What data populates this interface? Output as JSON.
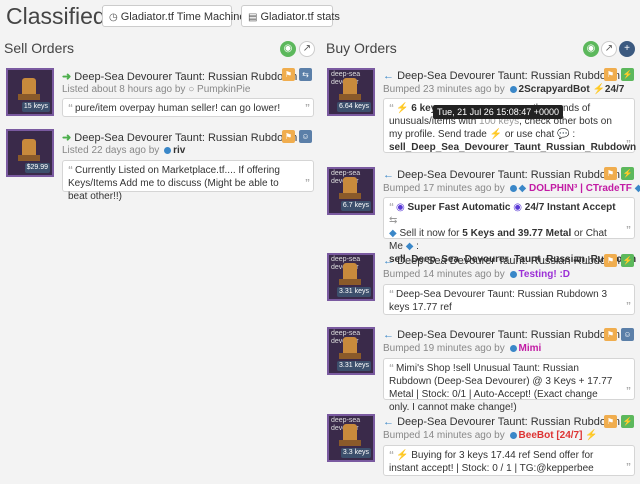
{
  "header": {
    "title": "Classifieds",
    "time_machine": "Gladiator.tf Time Machine",
    "stats": "Gladiator.tf stats"
  },
  "sell": {
    "title": "Sell Orders",
    "orders": [
      {
        "name": "Deep-Sea Devourer Taunt: Russian Rubdown",
        "meta": "Listed about 8 hours ago by",
        "user": "PumpkinPie",
        "price": "15 keys",
        "comment": "pure/item overpay human seller! can go lower!"
      },
      {
        "name": "Deep-Sea Devourer Taunt: Russian Rubdown",
        "meta": "Listed 22 days ago by",
        "user": "riv",
        "price": "$29.99",
        "comment": "Currently Listed on Marketplace.tf.... If offering Keys/Items Add me to discuss (Might be able to beat other!!)"
      }
    ]
  },
  "buy": {
    "title": "Buy Orders",
    "orders": [
      {
        "name": "Deep-Sea Devourer Taunt: Russian Rubdown",
        "meta": "Bumped 23 minutes ago by",
        "user": "2ScrapyardBot",
        "user_extra": "24/7",
        "price": "6.64 keys",
        "comment_a": "6 keys",
        "comment_b": "g thousands of",
        "comment_c": "unusuals/items with",
        "comment_d": ", check other bots on",
        "comment_e": "my profile. Send  trade",
        "comment_f": "or  use  chat",
        "comment_g": "sell_Deep_Sea_Devourer_Taunt_Russian_Rubdown"
      },
      {
        "name": "Deep-Sea Devourer Taunt: Russian Rubdown",
        "meta": "Bumped 17 minutes ago by",
        "user": "DOLPHIN³ | CTradeTF",
        "price": "6.7 keys",
        "comment_a": "Super Fast Automatic",
        "comment_b": "24/7 Instant Accept",
        "comment_c": "Sell it now for",
        "comment_d": "5 Keys and 39.77 Metal",
        "comment_e": "or Chat Me",
        "comment_f": "sell_Deep_Sea_Devourer_Taunt_Russian_Rubdown"
      },
      {
        "name": "Deep-Sea Devourer Taunt: Russian Rubdown",
        "meta": "Bumped 14 minutes ago by",
        "user": "Testing! :D",
        "price": "3.31 keys",
        "comment": "Deep-Sea Devourer Taunt: Russian Rubdown 3 keys 17.77 ref"
      },
      {
        "name": "Deep-Sea Devourer Taunt: Russian Rubdown",
        "meta": "Bumped 19 minutes ago by",
        "user": "Mimi",
        "price": "3.31 keys",
        "comment": "Mimi's Shop   !sell Unusual Taunt: Russian Rubdown (Deep-Sea Devourer) @ 3 Keys + 17.77 Metal |   Stock: 0/1 | Auto-Accept! (Exact change only. I cannot make change!)"
      },
      {
        "name": "Deep-Sea Devourer Taunt: Russian Rubdown",
        "meta": "Bumped 14 minutes ago by",
        "user": "BeeBot [24/7]",
        "price": "3.3 keys",
        "comment": "Buying for 3 keys 17.44 ref   Send offer for instant accept! | Stock: 0 / 1 | TG:@kepperbee"
      }
    ]
  },
  "tooltip": "Tue, 21 Jul 26 15:08:47 +0000",
  "item_label": "deep-sea devourer",
  "colors": {
    "accent_green": "#5cb85c",
    "accent_orange": "#f0ad4e",
    "accent_blue": "#3a87c8"
  }
}
